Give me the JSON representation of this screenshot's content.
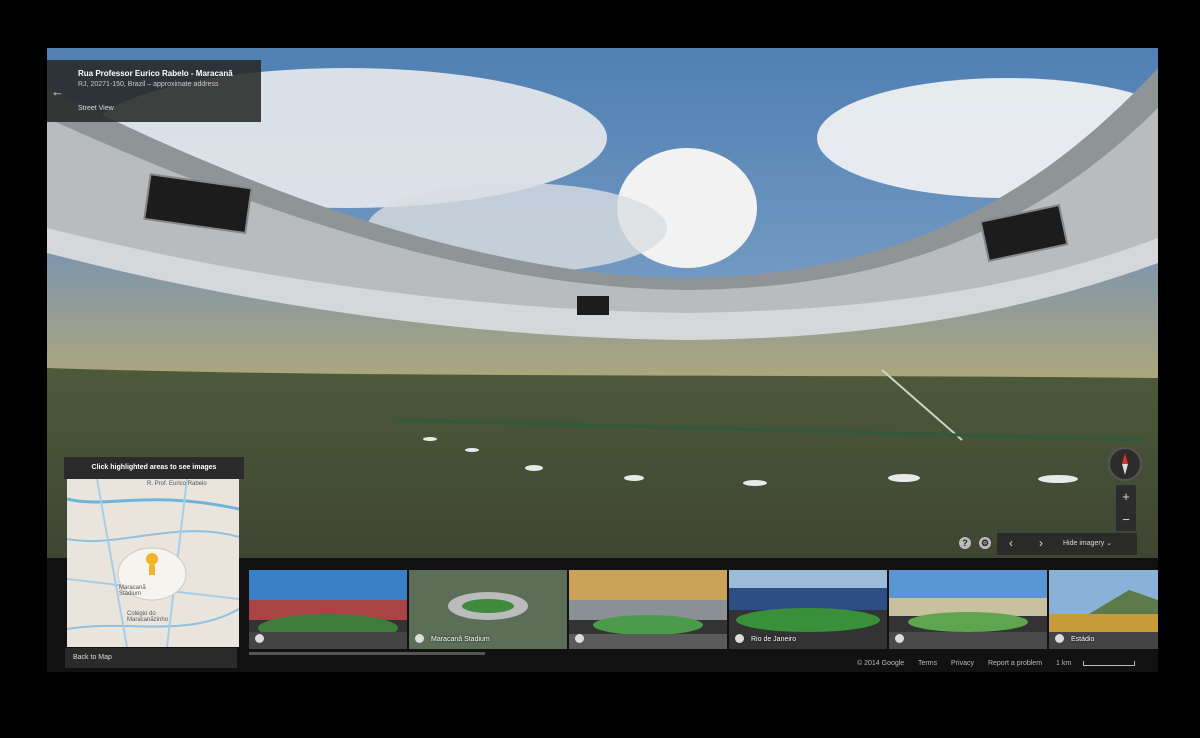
{
  "address": {
    "back_icon": "arrow-left-icon",
    "title": "Rua Professor Eurico Rabelo - Maracanã",
    "subtitle": "RJ, 20271-150, Brazil – approximate address",
    "mode": "Street View"
  },
  "map_panel": {
    "highlight_hint": "Click highlighted areas to see images",
    "back_label": "Back to Map",
    "labels": [
      "R. Prof. Eurico Rabelo",
      "Maracanã Stadium",
      "Colégio do Maracanãzinho"
    ]
  },
  "controls": {
    "compass_icon": "compass-icon",
    "zoom_in": "+",
    "zoom_out": "−",
    "prev": "‹",
    "next": "›",
    "hide_imagery": "Hide imagery",
    "hide_chevron": "⌄"
  },
  "thumbnails": [
    {
      "label": "",
      "icon": "photosphere-icon"
    },
    {
      "label": "Maracanã Stadium",
      "icon": "camera-icon"
    },
    {
      "label": "",
      "icon": "photosphere-icon"
    },
    {
      "label": "Rio de Janeiro",
      "icon": "camera-icon"
    },
    {
      "label": "",
      "icon": "photosphere-icon"
    },
    {
      "label": "Estádio",
      "icon": "camera-icon"
    }
  ],
  "footer": {
    "copyright": "© 2014 Google",
    "terms": "Terms",
    "privacy": "Privacy",
    "report": "Report a problem",
    "scale": "1 km"
  }
}
